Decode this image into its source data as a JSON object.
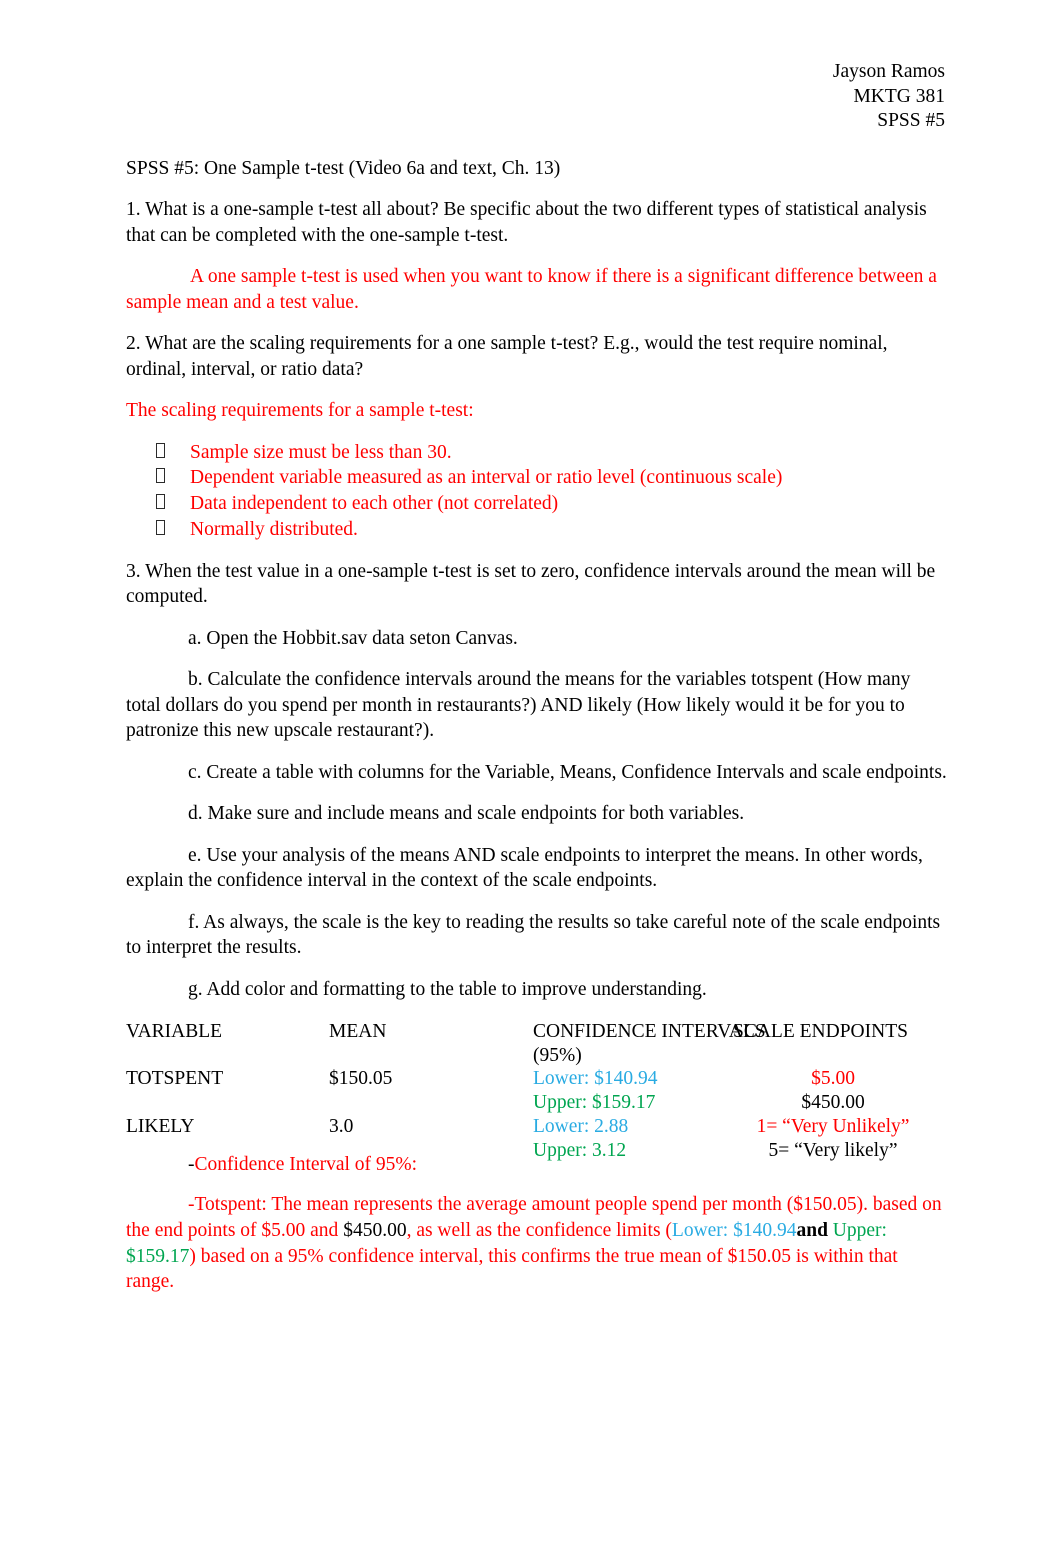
{
  "header": {
    "name": "Jayson Ramos",
    "course": "MKTG 381",
    "assignment": "SPSS #5"
  },
  "title": "SPSS #5: One Sample t-test (Video 6a and text, Ch. 13)",
  "questions": {
    "q1": {
      "prompt": "1. What is a one-sample t-test all about? Be specific about the two different types of statistical analysis that can be completed with the one-sample t-test.",
      "answer": "A one sample t-test is used when you want to know if there is a significant difference between a sample mean and a test value."
    },
    "q2": {
      "prompt": "2. What are the scaling requirements for a one sample t-test? E.g., would the test require nominal, ordinal, interval, or ratio data?",
      "answer_intro": "The scaling requirements for a sample t-test:",
      "bullets": [
        "Sample size must be less than 30.",
        "Dependent variable measured as an interval or ratio level (continuous scale)",
        "Data independent to each other (not correlated)",
        "Normally distributed."
      ]
    },
    "q3": {
      "prompt": "3. When the test value in a one-sample t-test is set to zero, confidence intervals around the mean will be computed.",
      "steps": [
        "a. Open the Hobbit.sav data seton Canvas.",
        "b. Calculate the confidence intervals around the means for the variables totspent (How many total dollars do you spend per month in restaurants?) AND likely (How likely would it be for you to patronize this new upscale restaurant?).",
        "c. Create a table with columns for the Variable, Means, Confidence Intervals and scale endpoints.",
        "d. Make sure and include means and scale endpoints for both variables.",
        "e. Use your analysis of the means AND scale endpoints to interpret the means. In other words, explain the confidence interval in the context of the scale endpoints.",
        "f. As always, the scale is the key to reading the results so take careful note of the scale endpoints to interpret the results.",
        "g. Add color and formatting to the table to improve understanding."
      ]
    }
  },
  "table": {
    "headers": {
      "variable": "VARIABLE",
      "mean": "MEAN",
      "confidence_interval": "CONFIDENCE INTERVALS",
      "confidence_interval_sub": "(95%)",
      "scale_endpoints": "SCALE ENDPOINTS"
    },
    "rows": [
      {
        "variable": "TOTSPENT",
        "mean": "$150.05",
        "ci_lower": "Lower: $140.94",
        "ci_upper": "Upper: $159.17",
        "endpoint_low": "$5.00",
        "endpoint_high": "$450.00"
      },
      {
        "variable": "LIKELY",
        "mean": "3.0",
        "ci_lower": "Lower: 2.88",
        "ci_upper": "Upper: 3.12",
        "endpoint_low": "1= “Very Unlikely”",
        "endpoint_high": "5= “Very likely”"
      }
    ]
  },
  "analysis": {
    "heading_dash": "-",
    "heading": "Confidence Interval of 95%:",
    "p1_a": "-Totspent: The mean represents the average amount people spend per month ($150.05). based on the end points of  $5.00 and ",
    "p1_b": "$450.00",
    "p1_c": ", as well as the confidence limits (",
    "p1_d": "Lower: $140.94",
    "p1_e": "and",
    "p1_f": " Upper: $159.17",
    "p1_g": ") based on a 95% confidence interval, this confirms the true mean of $150.05 is within that range."
  },
  "colors": {
    "red": "#FF0000",
    "cyan": "#29ABE2",
    "green": "#00A550",
    "black": "#000000"
  },
  "icons": {
    "bullet": "tofu-box-icon"
  }
}
